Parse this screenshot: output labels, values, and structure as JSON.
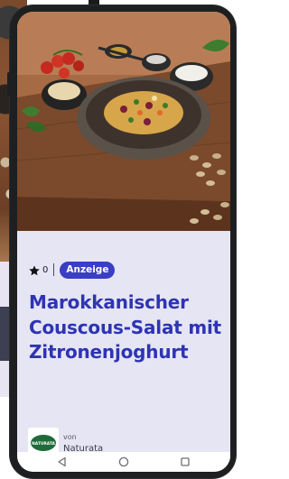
{
  "recipe_card": {
    "rating_count": "0",
    "ad_label": "Anzeige",
    "title": "Marokkanischer Couscous-Salat mit Zitronenjoghurt",
    "sponsor_prefix": "von",
    "sponsor_name": "Naturata",
    "sponsor_logo_text": "NATURATA"
  },
  "icons": {
    "rating": "star-icon",
    "back": "back-triangle-icon",
    "home": "home-circle-icon",
    "recents": "recents-square-icon"
  },
  "colors": {
    "title": "#2e34b4",
    "ad_badge": "#3a3ec4",
    "card_background": "#e6e5f3",
    "sponsor_logo": "#1f6b3a"
  }
}
